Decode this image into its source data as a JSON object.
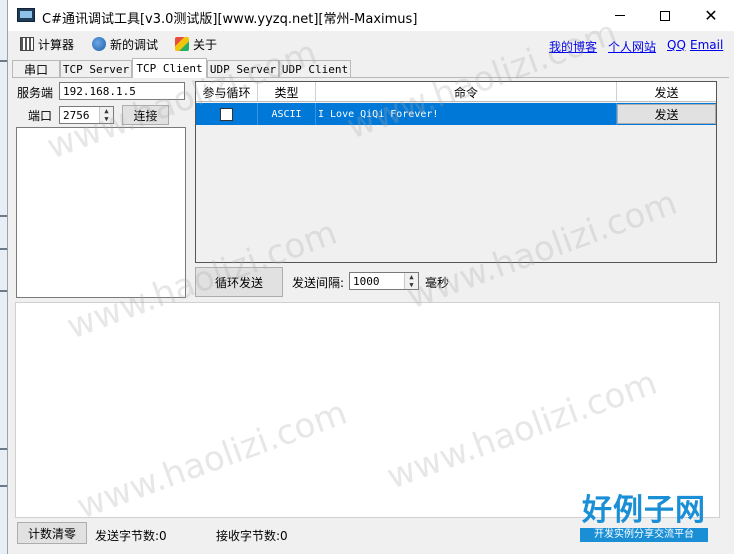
{
  "window": {
    "title": "C#通讯调试工具[v3.0测试版][www.yyzq.net][常州-Maximus]"
  },
  "menu": {
    "calculator": "计算器",
    "new_debug": "新的调试",
    "about": "关于"
  },
  "links": {
    "blog": "我的博客",
    "personal_site": "个人网站",
    "qq": "QQ",
    "email": "Email"
  },
  "tabs": [
    {
      "label": "串口",
      "active": false
    },
    {
      "label": "TCP Server",
      "active": false
    },
    {
      "label": "TCP Client",
      "active": true
    },
    {
      "label": "UDP Server",
      "active": false
    },
    {
      "label": "UDP Client",
      "active": false
    }
  ],
  "connection": {
    "server_label": "服务端",
    "server_value": "192.168.1.5",
    "port_label": "端口",
    "port_value": "2756",
    "connect_button": "连接"
  },
  "grid": {
    "columns": [
      "参与循环",
      "类型",
      "命令",
      "发送"
    ],
    "rows": [
      {
        "loop": false,
        "type": "ASCII",
        "command": "I Love QiQi Forever!",
        "send": "发送"
      }
    ]
  },
  "loop": {
    "button": "循环发送",
    "interval_label": "发送间隔:",
    "interval_value": "1000",
    "unit": "毫秒"
  },
  "status": {
    "clear_button": "计数清零",
    "sent_bytes": "发送字节数:0",
    "received_bytes": "接收字节数:0"
  },
  "watermark": {
    "text": "www.haolizi.com",
    "brand_name": "好例子网",
    "brand_slogan": "开发实例分享交流平台"
  },
  "colors": {
    "selection": "#0078d7",
    "link": "#0000ee",
    "brand": "#1a8fd6"
  }
}
